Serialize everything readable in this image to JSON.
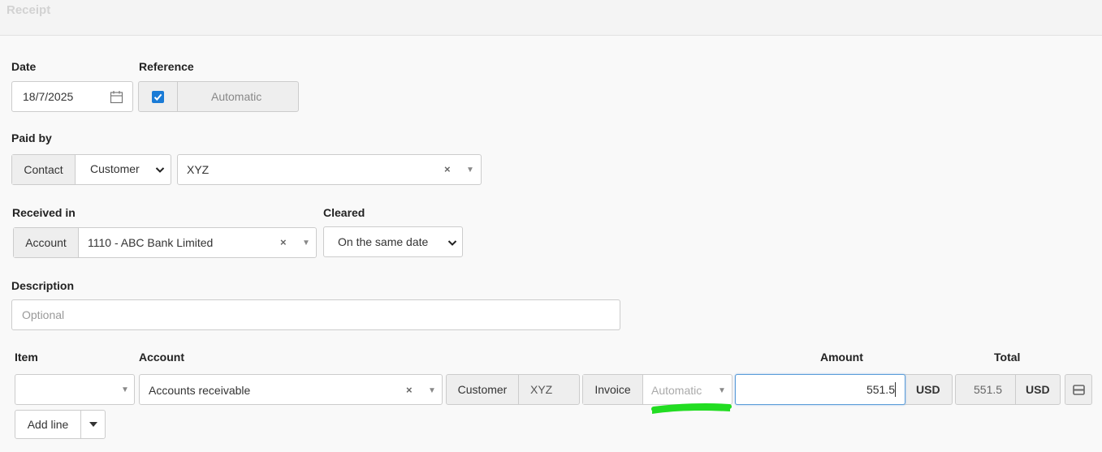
{
  "header": {
    "title": "Receipt"
  },
  "date": {
    "label": "Date",
    "value": "18/7/2025"
  },
  "reference": {
    "label": "Reference",
    "value": "Automatic",
    "checked": true
  },
  "paid_by": {
    "label": "Paid by",
    "contact_label": "Contact",
    "type_value": "Customer",
    "contact_value": "XYZ"
  },
  "received_in": {
    "label": "Received in",
    "account_label": "Account",
    "account_value": "1110 - ABC Bank Limited"
  },
  "cleared": {
    "label": "Cleared",
    "value": "On the same date"
  },
  "description": {
    "label": "Description",
    "placeholder": "Optional"
  },
  "lines": {
    "headers": {
      "item": "Item",
      "account": "Account",
      "amount": "Amount",
      "total": "Total"
    },
    "row": {
      "item_value": "",
      "account_value": "Accounts receivable",
      "customer_label": "Customer",
      "customer_value": "XYZ",
      "invoice_label": "Invoice",
      "invoice_placeholder": "Automatic",
      "amount_value": "551.5",
      "amount_currency": "USD",
      "total_value": "551.5",
      "total_currency": "USD"
    },
    "add_line_label": "Add line"
  },
  "colors": {
    "accent": "#1a7bd6",
    "highlight": "#22dd22",
    "checkbox": "#1a7bd6"
  }
}
